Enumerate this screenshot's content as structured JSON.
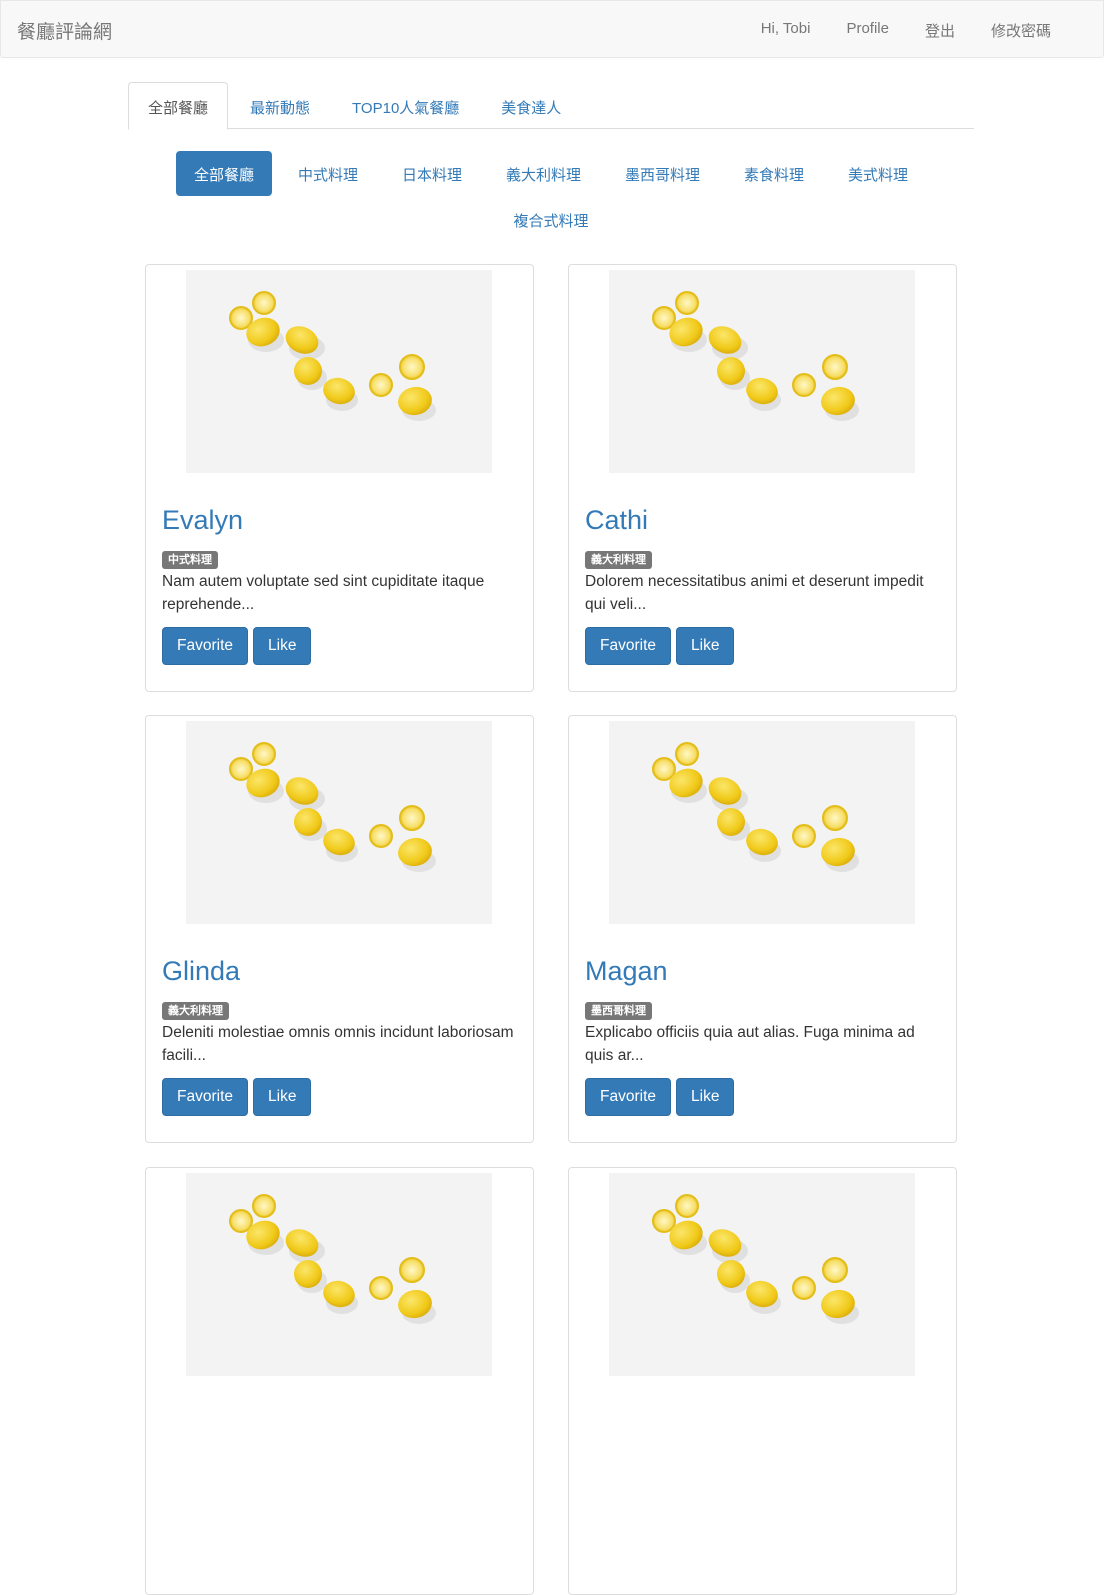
{
  "navbar": {
    "brand": "餐廳評論網",
    "greeting": "Hi, Tobi",
    "profile": "Profile",
    "logout": "登出",
    "change_password": "修改密碼"
  },
  "tabs": [
    "全部餐廳",
    "最新動態",
    "TOP10人氣餐廳",
    "美食達人"
  ],
  "categories": [
    "全部餐廳",
    "中式料理",
    "日本料理",
    "義大利料理",
    "墨西哥料理",
    "素食料理",
    "美式料理",
    "複合式料理"
  ],
  "restaurants": [
    {
      "name": "Evalyn",
      "category": "中式料理",
      "description": "Nam autem voluptate sed sint cupiditate itaque reprehende..."
    },
    {
      "name": "Cathi",
      "category": "義大利料理",
      "description": "Dolorem necessitatibus animi et deserunt impedit qui veli..."
    },
    {
      "name": "Glinda",
      "category": "義大利料理",
      "description": "Deleniti molestiae omnis omnis incidunt laboriosam facili..."
    },
    {
      "name": "Magan",
      "category": "墨西哥料理",
      "description": "Explicabo officiis quia aut alias. Fuga minima ad quis ar..."
    },
    {
      "name": "",
      "category": "",
      "description": ""
    },
    {
      "name": "",
      "category": "",
      "description": ""
    }
  ],
  "buttons": {
    "favorite": "Favorite",
    "like": "Like"
  },
  "colors": {
    "primary": "#337ab7",
    "badge": "#777777",
    "lemon": "#f2cf2a"
  }
}
